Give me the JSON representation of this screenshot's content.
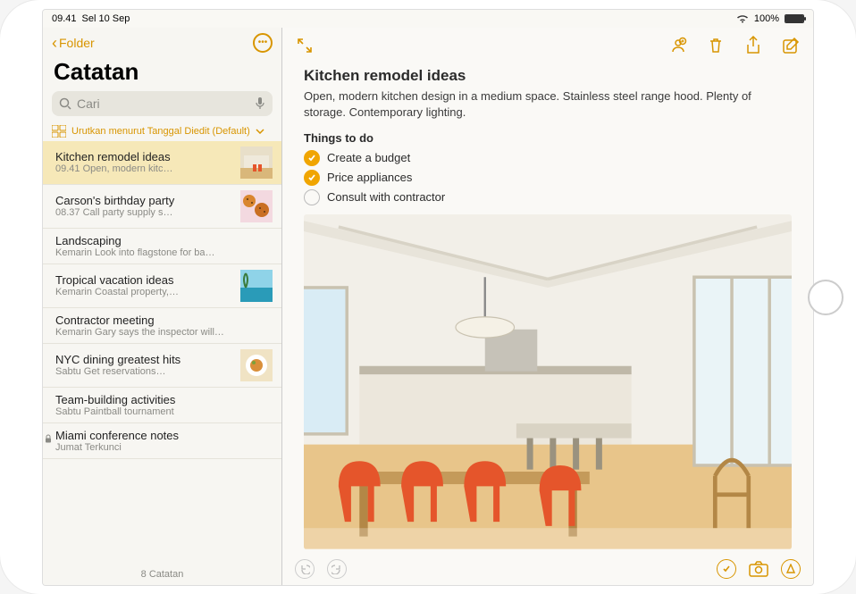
{
  "status": {
    "time": "09.41",
    "date": "Sel 10 Sep",
    "battery_pct": "100%"
  },
  "sidebar": {
    "back_label": "Folder",
    "title": "Catatan",
    "search_placeholder": "Cari",
    "sort_label": "Urutkan menurut Tanggal Diedit (Default)",
    "footer": "8 Catatan",
    "notes": [
      {
        "title": "Kitchen remodel ideas",
        "time": "09.41",
        "preview": "Open, modern kitc…",
        "selected": true,
        "thumb": "kitchen"
      },
      {
        "title": "Carson's birthday party",
        "time": "08.37",
        "preview": "Call party supply s…",
        "thumb": "cookies"
      },
      {
        "title": "Landscaping",
        "time": "Kemarin",
        "preview": "Look into flagstone for ba…"
      },
      {
        "title": "Tropical vacation ideas",
        "time": "Kemarin",
        "preview": "Coastal property,…",
        "thumb": "beach"
      },
      {
        "title": "Contractor meeting",
        "time": "Kemarin",
        "preview": "Gary says the inspector will…"
      },
      {
        "title": "NYC dining greatest hits",
        "time": "Sabtu",
        "preview": "Get reservations…",
        "thumb": "food"
      },
      {
        "title": "Team-building activities",
        "time": "Sabtu",
        "preview": "Paintball tournament"
      },
      {
        "title": "Miami conference notes",
        "time": "Jumat",
        "preview": "Terkunci",
        "locked": true
      }
    ]
  },
  "detail": {
    "title": "Kitchen remodel ideas",
    "body": "Open, modern kitchen design in a medium space. Stainless steel range hood. Plenty of storage. Contemporary lighting.",
    "checklist_title": "Things to do",
    "checklist": [
      {
        "label": "Create a budget",
        "checked": true
      },
      {
        "label": "Price appliances",
        "checked": true
      },
      {
        "label": "Consult with contractor",
        "checked": false
      }
    ]
  },
  "colors": {
    "accent": "#d89500"
  }
}
